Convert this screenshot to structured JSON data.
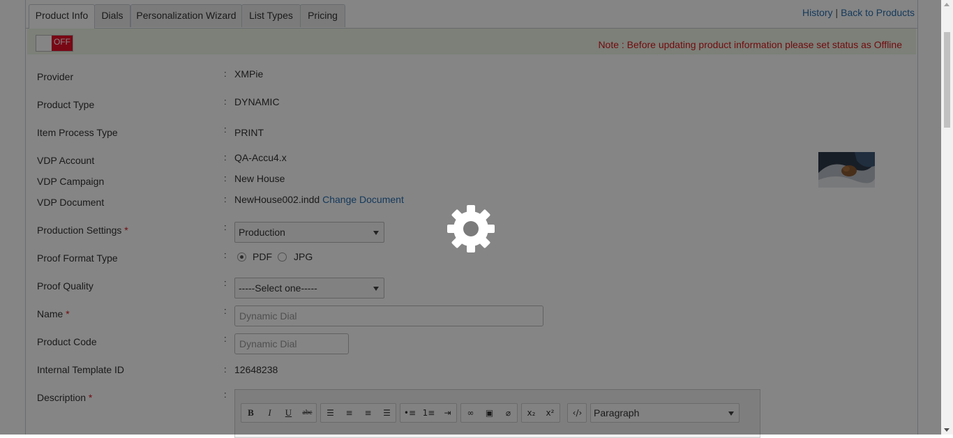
{
  "tabs": [
    {
      "label": "Product Info",
      "active": true
    },
    {
      "label": "Dials",
      "active": false
    },
    {
      "label": "Personalization Wizard",
      "active": false
    },
    {
      "label": "List Types",
      "active": false
    },
    {
      "label": "Pricing",
      "active": false
    }
  ],
  "top_links": {
    "history": "History",
    "separator": "|",
    "back": "Back to Products"
  },
  "status": {
    "toggle_label": "OFF",
    "note": "Note : Before updating product information please set status as Offline"
  },
  "form": {
    "provider": {
      "label": "Provider",
      "value": "XMPie"
    },
    "product_type": {
      "label": "Product Type",
      "value": "DYNAMIC"
    },
    "item_process_type": {
      "label": "Item Process Type",
      "value": "PRINT"
    },
    "vdp_account": {
      "label": "VDP Account",
      "value": "QA-Accu4.x"
    },
    "vdp_campaign": {
      "label": "VDP Campaign",
      "value": "New House"
    },
    "vdp_document": {
      "label": "VDP Document",
      "value": "NewHouse002.indd",
      "link": "Change Document"
    },
    "production_settings": {
      "label": "Production Settings",
      "required": "*",
      "value": "Production"
    },
    "proof_format_type": {
      "label": "Proof Format Type",
      "options": [
        "PDF",
        "JPG"
      ],
      "selected": "PDF"
    },
    "proof_quality": {
      "label": "Proof Quality",
      "value": "-----Select one-----"
    },
    "name": {
      "label": "Name",
      "required": "*",
      "placeholder": "Dynamic Dial"
    },
    "product_code": {
      "label": "Product Code",
      "placeholder": "Dynamic Dial"
    },
    "internal_template_id": {
      "label": "Internal Template ID",
      "value": "12648238"
    },
    "description": {
      "label": "Description",
      "required": "*"
    }
  },
  "colon": ":",
  "editor": {
    "buttons_text": [
      "B",
      "I",
      "U",
      "abc"
    ],
    "format_select": "Paragraph",
    "font_select": "(inherited font)",
    "size_select": "(inherited size)"
  },
  "colors": {
    "overlay": "#000000",
    "note_red": "#d9161c",
    "link_blue": "#2a6fb0",
    "toggle_off": "#e8102a",
    "status_bar": "#edf5e6"
  },
  "icons": {
    "loading": "gear-icon"
  }
}
